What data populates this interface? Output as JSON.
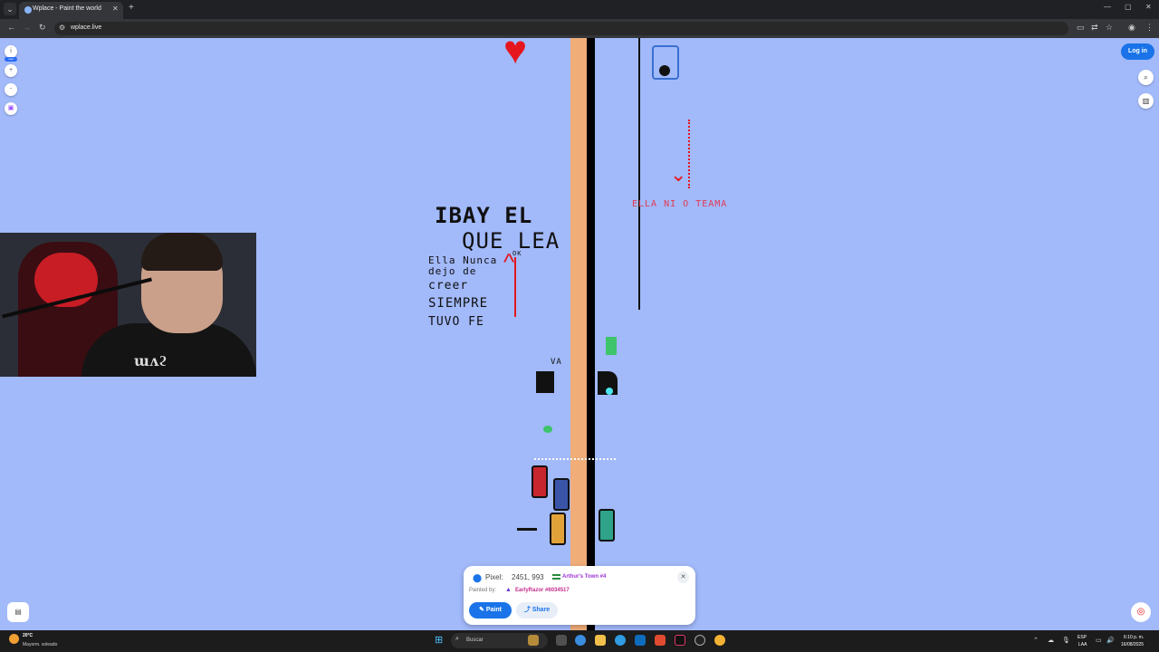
{
  "browser": {
    "tab_title": "Wplace - Paint the world",
    "url": "wplace.live"
  },
  "canvas_art": {
    "text_left_line1": "IBAY EL",
    "text_left_line2": "QUE LEA",
    "text_left_small1": "Ella Nunca",
    "text_left_small2": "dejo de",
    "text_left_small3": "creer",
    "text_left_small4": "SIEMPRE",
    "text_left_small5": "TUVO FE",
    "text_right_red": "ELLA NI O TEAMA",
    "text_va": "VA",
    "text_ok": "OK"
  },
  "header": {
    "login_label": "Log in",
    "new_badge": "new"
  },
  "pixel_panel": {
    "pixel_label": "Pixel:",
    "coords": "2451, 993",
    "town": "Arthur's Town #4",
    "painted_by_label": "Painted by:",
    "painter": "EarlyRazor #6034517",
    "paint_label": "Paint",
    "share_label": "Share"
  },
  "taskbar": {
    "temperature": "20°C",
    "weather": "Mayorm. soleado",
    "search_placeholder": "Buscar",
    "lang_top": "ESP",
    "lang_bottom": "LAA",
    "time": "6:10 p. m.",
    "date": "16/08/2025"
  },
  "colors": {
    "canvas_bg": "#a2b9fa",
    "road": "#f0ad78",
    "accent": "#1a73e8"
  }
}
